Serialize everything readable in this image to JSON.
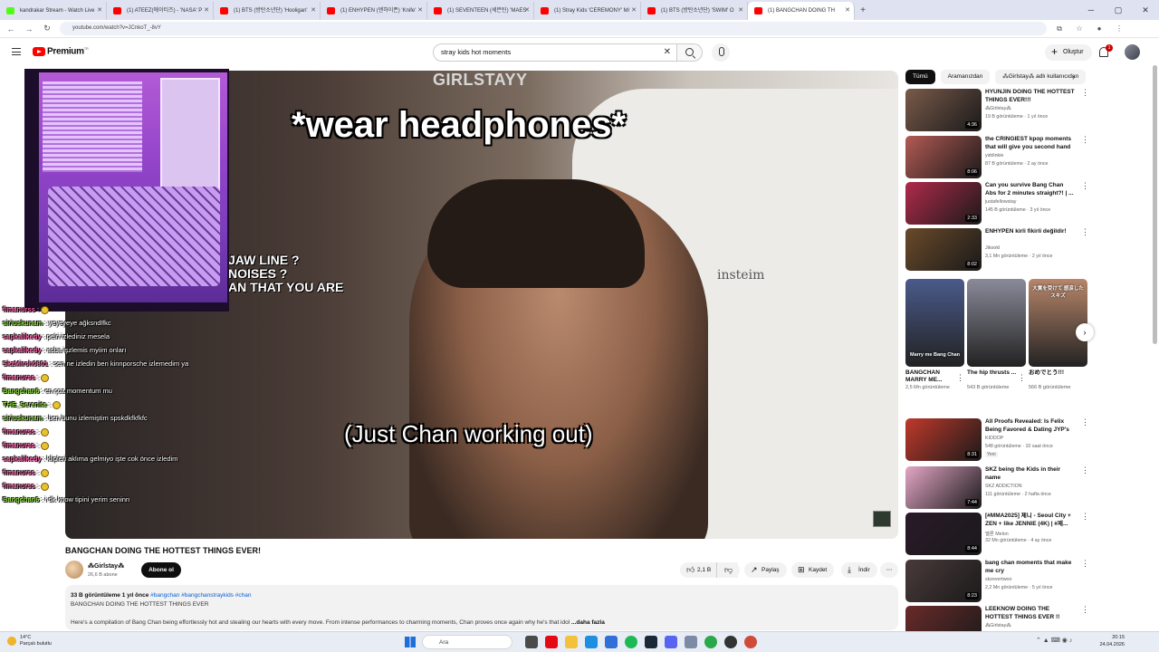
{
  "browser": {
    "tabs": [
      {
        "label": "kandrakar Stream - Watch Live",
        "favicon": "kick-icon",
        "active": false
      },
      {
        "label": "(1) ATEEZ(에이티즈) - 'NASA' P",
        "favicon": "youtube-icon",
        "active": false
      },
      {
        "label": "(1) BTS (방탄소년단) 'Hooligan'",
        "favicon": "youtube-icon",
        "active": false
      },
      {
        "label": "(1) ENHYPEN (엔하이픈) 'Knife'",
        "favicon": "youtube-icon",
        "active": false
      },
      {
        "label": "(1) SEVENTEEN (세븐틴) 'MAES",
        "favicon": "youtube-icon",
        "active": false
      },
      {
        "label": "(1) Stray Kids 'CEREMONY' M/",
        "favicon": "youtube-icon",
        "active": false
      },
      {
        "label": "(1) BTS (방탄소년단) 'SWIM' O",
        "favicon": "youtube-icon",
        "active": false
      },
      {
        "label": "(1) BANGCHAN DOING TH",
        "favicon": "youtube-icon",
        "active": true
      }
    ],
    "url": "youtube.com/watch?v=JCnkoT_-8vY"
  },
  "youtube": {
    "brand": "Premium",
    "brand_sup": "TR",
    "search_query": "stray kids hot moments",
    "create_label": "Oluştur",
    "notification_count": "1"
  },
  "video": {
    "watermark": "GIRLSTAYY",
    "caption_top": "*wear headphones*",
    "caption_bottom": "(Just Chan working out)",
    "side_text": "JAW LINE ?\nNOISES ?\nAN THAT YOU ARE",
    "shirt_text": "insteim",
    "title": "BANGCHAN DOING THE HOTTEST THINGS EVER!",
    "channel": "⁂Girlstay⁂",
    "subscribers": "26,6 B abone",
    "subscribe_label": "Abone ol",
    "likes": "2,1 B",
    "share_label": "Paylaş",
    "save_label": "Kaydet",
    "download_label": "İndir",
    "views_date": "33 B görüntüleme  1 yıl önce",
    "hashtags": "#bangchan #bangchanstraykids #chan",
    "desc_title": "BANGCHAN DOING THE HOTTEST THINGS EVER",
    "desc_body": "Here's a compilation of Bang Chan being effortlessly hot and stealing our hearts with every move. From intense performances to charming moments, Chan proves once again why he's that idol",
    "more_label": "...daha fazla"
  },
  "chat": [
    {
      "user": "fimanurss",
      "color": "#ff5ea8",
      "text": ""
    },
    {
      "user": "siriuskunam",
      "color": "#8bd93a",
      "text": "yeyeyeye ağksndlfkc"
    },
    {
      "user": "sapkalikedy",
      "color": "#ff5ea8",
      "text": "pelri izlediniz mesela"
    },
    {
      "user": "sapkalikedy",
      "color": "#ff5ea8",
      "text": "asba işzlemis myiim onları"
    },
    {
      "user": "SkzMiroh0801",
      "color": "#ff5ea8",
      "text": "sen ne izledin ben kinnporsche izlemedim ya"
    },
    {
      "user": "fimanurss",
      "color": "#ff5ea8",
      "text": ""
    },
    {
      "user": "Bangchan6",
      "color": "#8bd93a",
      "text": "en çoz momentum mu"
    },
    {
      "user": "THE_Serenite",
      "color": "#8bd93a",
      "text": ""
    },
    {
      "user": "siriuskunam",
      "color": "#8bd93a",
      "text": "ben bunu izlemiştim spskdkfkfkfc"
    },
    {
      "user": "fimanurss",
      "color": "#ff5ea8",
      "text": ""
    },
    {
      "user": "fimanurss",
      "color": "#ff5ea8",
      "text": ""
    },
    {
      "user": "sapkalikedy",
      "color": "#ff5ea8",
      "text": "klipleri aklıma gelmiyo işte cok önce izledim"
    },
    {
      "user": "fimanurss",
      "color": "#ff5ea8",
      "text": ""
    },
    {
      "user": "fimanurss",
      "color": "#ff5ea8",
      "text": ""
    },
    {
      "user": "Bangchan6",
      "color": "#8bd93a",
      "text": "i dk know tipini yerim seninn"
    }
  ],
  "chips": [
    "Tümü",
    "Aramanızdan",
    "⁂Girlstay⁂ adlı kullanıcıdan"
  ],
  "recommendations": [
    {
      "title": "HYUNJIN DOING THE HOTTEST THINGS EVER!!!",
      "channel": "⁂Girlstay⁂",
      "meta": "19 B görüntüleme · 1 yıl önce",
      "duration": "4:36",
      "color": "#7a5a4a",
      "badge": ""
    },
    {
      "title": "the CRINGIEST kpop moments that will give you second hand ...",
      "channel": "ysblinkie",
      "meta": "87 B görüntüleme · 2 ay önce",
      "duration": "8:06",
      "color": "#b35a54",
      "badge": ""
    },
    {
      "title": "Can you survive Bang Chan Abs for 2 minutes straight?! | ...",
      "channel": "justafellowstay",
      "meta": "145 B görüntüleme · 3 yıl önce",
      "duration": "2:33",
      "color": "#b02a4a",
      "badge": ""
    },
    {
      "title": "ENHYPEN kirli fikirli değildir!",
      "channel": "Jikookl",
      "meta": "3,1 Mn görüntüleme · 2 yıl önce",
      "duration": "8:02",
      "color": "#6a4a2a",
      "badge": ""
    },
    {
      "title": "All Proofs Revealed: Is Felix Being Favored & Dating JYP's ...",
      "channel": "KIDDOP",
      "meta": "548 görüntüleme · 10 saat önce",
      "duration": "8:31",
      "color": "#c0392b",
      "badge": "Yeni"
    },
    {
      "title": "SKZ being the Kids in their name",
      "channel": "SKZ ADDICTION",
      "meta": "111 görüntüleme · 2 hafta önce",
      "duration": "7:44",
      "color": "#e4a6c6",
      "badge": ""
    },
    {
      "title": "[#MMA2025] 제니 - Seoul City + ZEN + like JENNIE (4K) | #제...",
      "channel": "멜론 Melon",
      "meta": "32 Mn görüntüleme · 4 ay önce",
      "duration": "8:44",
      "color": "#2a1a2a",
      "badge": ""
    },
    {
      "title": "bang chan moments that make me cry",
      "channel": "skzevertwoo",
      "meta": "2,2 Mn görüntüleme · 5 yıl önce",
      "duration": "8:23",
      "color": "#4a3a3a",
      "badge": ""
    },
    {
      "title": "LEEKNOW DOING THE HOTTEST THINGS EVER !!",
      "channel": "⁂Girlstay⁂",
      "meta": "",
      "duration": "",
      "color": "#6a2a2a",
      "badge": ""
    }
  ],
  "shorts": [
    {
      "title": "BANGCHAN MARRY ME...",
      "views": "2,5 Mn görüntüleme",
      "color": "#4a5a8a",
      "overlay": "Marry me Bang Chan"
    },
    {
      "title": "The hip thrusts ...",
      "views": "543 B görüntüleme",
      "color": "#8a8a9a",
      "overlay": ""
    },
    {
      "title": "おめでとう!!!",
      "views": "566 B görüntüleme",
      "color": "#b8866a",
      "overlay": "大賞を受けて 感涙したスキズ"
    }
  ],
  "taskbar": {
    "temperature": "14°C",
    "weather": "Parçalı bulutlu",
    "search_label": "Ara",
    "time": "20:15",
    "date": "24.04.2026"
  }
}
